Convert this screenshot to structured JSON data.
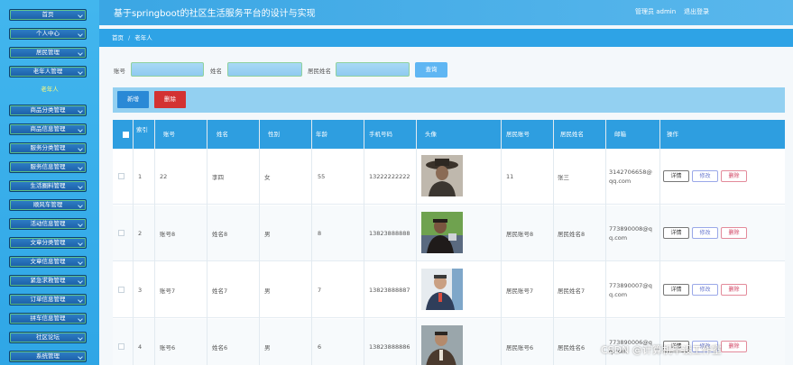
{
  "app": {
    "title": "基于springboot的社区生活服务平台的设计与实现",
    "admin_label": "管理员 admin",
    "logout_label": "退出登录"
  },
  "breadcrumb": {
    "home": "首页",
    "separator": "/",
    "current": "老年人"
  },
  "sidebar": {
    "items": [
      {
        "label": "首页"
      },
      {
        "label": "个人中心"
      },
      {
        "label": "居民管理"
      },
      {
        "label": "老年人管理"
      },
      {
        "label": "老年人",
        "sub": true
      },
      {
        "label": "商品分类管理"
      },
      {
        "label": "商品信息管理"
      },
      {
        "label": "服务分类管理"
      },
      {
        "label": "服务信息管理"
      },
      {
        "label": "生活圈料管理"
      },
      {
        "label": "顺风车管理"
      },
      {
        "label": "活动信息管理"
      },
      {
        "label": "文章分类管理"
      },
      {
        "label": "文章信息管理"
      },
      {
        "label": "紧急求救管理"
      },
      {
        "label": "订单信息管理"
      },
      {
        "label": "拼车信息管理"
      },
      {
        "label": "社区论坛"
      },
      {
        "label": "系统管理"
      }
    ]
  },
  "search": {
    "account_label": "账号",
    "name_label": "姓名",
    "resident_name_label": "居民姓名",
    "button_label": "查询"
  },
  "actions": {
    "add_label": "新增",
    "delete_label": "删除"
  },
  "table": {
    "headers": [
      "索引",
      "账号",
      "姓名",
      "性别",
      "年龄",
      "手机号码",
      "头像",
      "居民账号",
      "居民姓名",
      "邮箱",
      "操作"
    ],
    "rows": [
      {
        "index": "1",
        "account": "22",
        "name": "李四",
        "gender": "女",
        "age": "55",
        "phone": "13222222222",
        "resident_account": "11",
        "resident_name": "张三",
        "email_line1": "3142706658@",
        "email_line2": "qq.com"
      },
      {
        "index": "2",
        "account": "账号8",
        "name": "姓名8",
        "gender": "男",
        "age": "8",
        "phone": "13823888888",
        "resident_account": "居民账号8",
        "resident_name": "居民姓名8",
        "email_line1": "773890008@q",
        "email_line2": "q.com"
      },
      {
        "index": "3",
        "account": "账号7",
        "name": "姓名7",
        "gender": "男",
        "age": "7",
        "phone": "13823888887",
        "resident_account": "居民账号7",
        "resident_name": "居民姓名7",
        "email_line1": "773890007@q",
        "email_line2": "q.com"
      },
      {
        "index": "4",
        "account": "账号6",
        "name": "姓名6",
        "gender": "男",
        "age": "6",
        "phone": "13823888886",
        "resident_account": "居民账号6",
        "resident_name": "居民姓名6",
        "email_line1": "773890006@q",
        "email_line2": "q.com"
      }
    ],
    "op_detail": "详情",
    "op_edit": "修改",
    "op_delete": "删除"
  },
  "watermark": "CSDN @计算机毕设工作室",
  "colors": {
    "sidebar": "#42b6ee",
    "header": "#3aa6e4",
    "table_header": "#2e9ee0",
    "add": "#2a89d6",
    "delete": "#d33232"
  }
}
